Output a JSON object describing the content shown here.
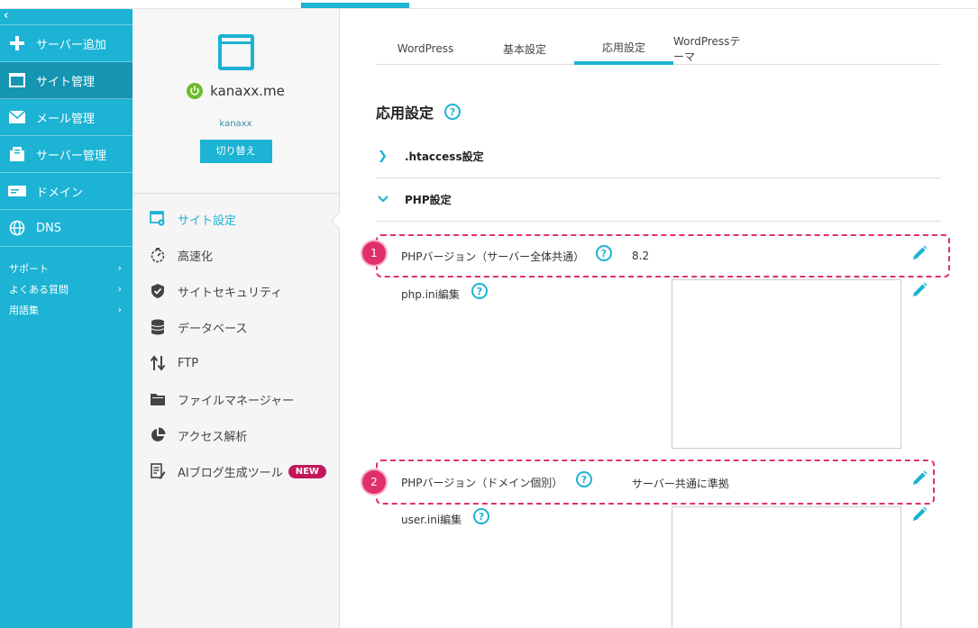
{
  "leftnav": {
    "collapse_icon": "‹",
    "items": [
      {
        "label": "サーバー追加",
        "icon": "plus-icon"
      },
      {
        "label": "サイト管理",
        "icon": "window-icon"
      },
      {
        "label": "メール管理",
        "icon": "mail-icon"
      },
      {
        "label": "サーバー管理",
        "icon": "server-icon"
      },
      {
        "label": "ドメイン",
        "icon": "domain-icon"
      },
      {
        "label": "DNS",
        "icon": "globe-icon"
      }
    ],
    "links": [
      {
        "label": "サポート"
      },
      {
        "label": "よくある質問"
      },
      {
        "label": "用語集"
      }
    ]
  },
  "site": {
    "domain": "kanaxx.me",
    "user": "kanaxx",
    "switch_label": "切り替え"
  },
  "menu": [
    {
      "label": "サイト設定",
      "icon": "site-settings-icon"
    },
    {
      "label": "高速化",
      "icon": "stopwatch-icon"
    },
    {
      "label": "サイトセキュリティ",
      "icon": "shield-icon"
    },
    {
      "label": "データベース",
      "icon": "database-icon"
    },
    {
      "label": "FTP",
      "icon": "transfer-icon"
    },
    {
      "label": "ファイルマネージャー",
      "icon": "folder-icon"
    },
    {
      "label": "アクセス解析",
      "icon": "pie-chart-icon"
    },
    {
      "label": "AIブログ生成ツール",
      "icon": "ai-blog-icon",
      "badge": "NEW"
    }
  ],
  "tabs": [
    {
      "label": "WordPress"
    },
    {
      "label": "基本設定"
    },
    {
      "label": "応用設定"
    },
    {
      "label": "WordPressテーマ"
    }
  ],
  "main": {
    "heading": "応用設定",
    "help_glyph": "?",
    "htaccess_label": ".htaccess設定",
    "php_section_label": "PHP設定",
    "php_version_server_label": "PHPバージョン（サーバー全体共通）",
    "php_version_server_value": "8.2",
    "php_ini_label": "php.ini編集",
    "php_version_domain_label": "PHPバージョン（ドメイン個別）",
    "php_version_domain_value": "サーバー共通に準拠",
    "user_ini_label": "user.ini編集",
    "marker_1": "1",
    "marker_2": "2"
  },
  "colors": {
    "accent": "#1cb3d4",
    "active_nav": "#1595b1",
    "highlight": "#e0306a",
    "new_badge": "#c2185b"
  }
}
